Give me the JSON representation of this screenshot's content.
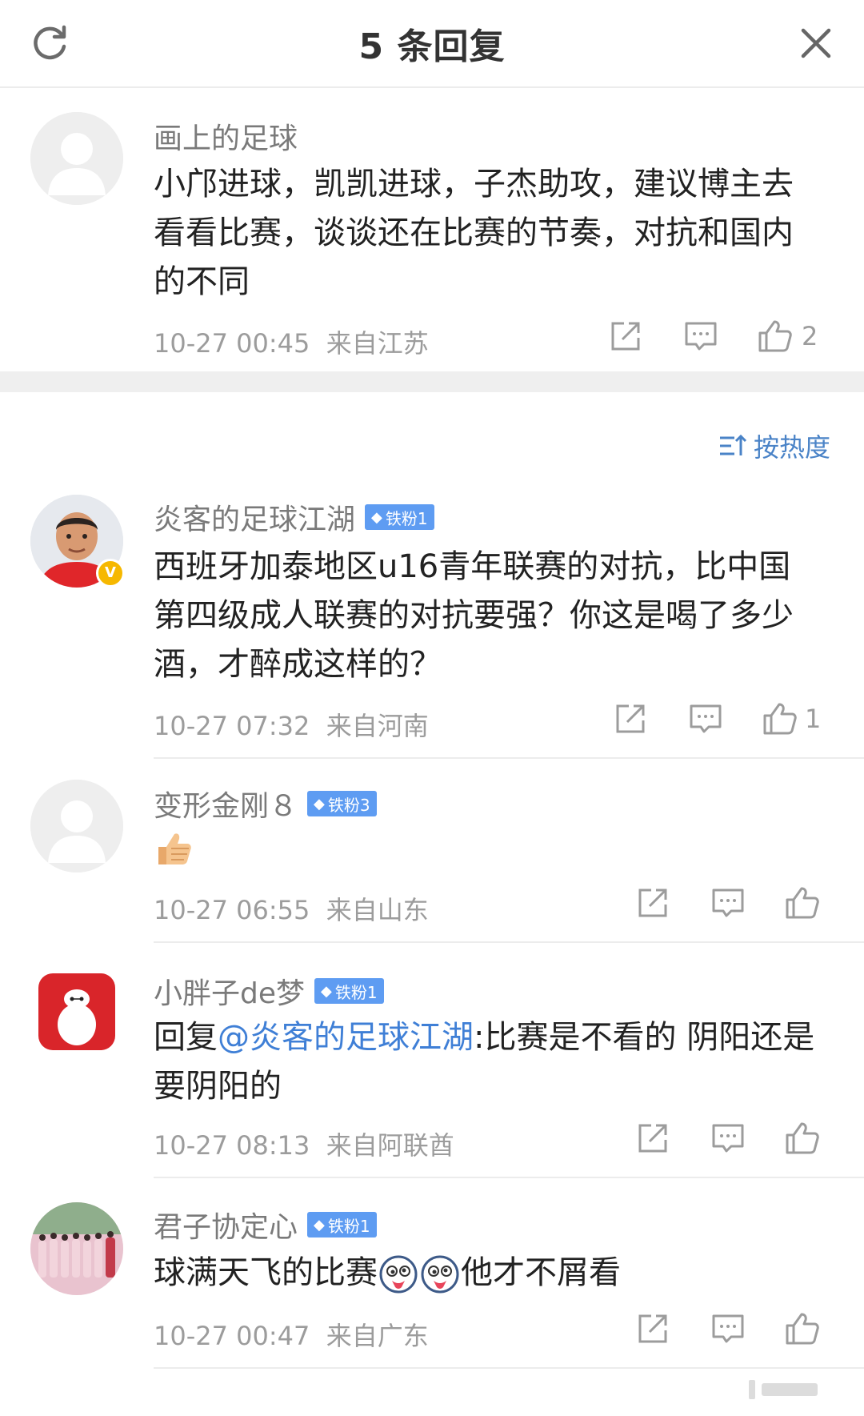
{
  "header": {
    "title": "5 条回复"
  },
  "root": {
    "username": "画上的足球",
    "text": "小邝进球，凯凯进球，子杰助攻，建议博主去看看比赛，谈谈还在比赛的节奏，对抗和国内的不同",
    "time": "10-27 00:45",
    "location": "来自江苏",
    "likes": "2"
  },
  "sort": {
    "label": "按热度"
  },
  "comments": [
    {
      "username": "炎客的足球江湖",
      "badge": "铁粉1",
      "text": "西班牙加泰地区u16青年联赛的对抗，比中国第四级成人联赛的对抗要强？你这是喝了多少酒，才醉成这样的？",
      "time": "10-27 07:32",
      "location": "来自河南",
      "likes": "1",
      "verified": true
    },
    {
      "username": "变形金刚８",
      "badge": "铁粉3",
      "emoji": "thumbs-up-emoji",
      "time": "10-27 06:55",
      "location": "来自山东",
      "likes": ""
    },
    {
      "username": "小胖子de梦",
      "badge": "铁粉1",
      "reply_prefix": "回复",
      "mention": "@炎客的足球江湖",
      "text": ":比赛是不看的 阴阳还是要阴阳的",
      "time": "10-27 08:13",
      "location": "来自阿联酋",
      "likes": ""
    },
    {
      "username": "君子协定心",
      "badge": "铁粉1",
      "text_a": "球满天飞的比赛",
      "text_b": "他才不屑看",
      "time": "10-27 00:47",
      "location": "来自广东",
      "likes": ""
    }
  ],
  "colors": {
    "accent": "#4a83c7",
    "badge": "#5e9cf2",
    "mention": "#3f7fd6",
    "meta": "#9c9c9c"
  }
}
